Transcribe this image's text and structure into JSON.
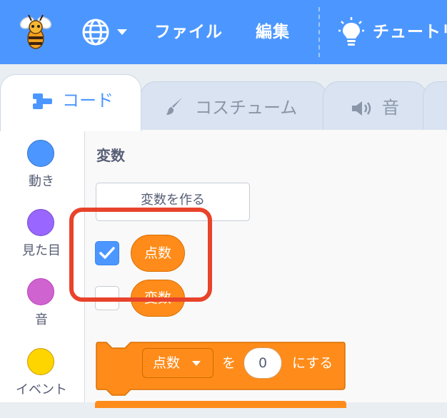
{
  "menubar": {
    "language_icon": "globe-icon",
    "file_label": "ファイル",
    "edit_label": "編集",
    "tutorials_label": "チュートリ",
    "tutorials_icon": "lightbulb-icon",
    "bg_color": "#4c97ff"
  },
  "tabs": [
    {
      "label": "コード",
      "icon": "code-blocks-icon",
      "active": true
    },
    {
      "label": "コスチューム",
      "icon": "paintbrush-icon",
      "active": false
    },
    {
      "label": "音",
      "icon": "speaker-icon",
      "active": false
    }
  ],
  "categories": [
    {
      "label": "動き",
      "color": "#4c97ff"
    },
    {
      "label": "見た目",
      "color": "#9966ff"
    },
    {
      "label": "音",
      "color": "#cf63cf"
    },
    {
      "label": "イベント",
      "color": "#ffd500"
    }
  ],
  "palette": {
    "section_title": "変数",
    "make_variable_label": "変数を作る",
    "variables": [
      {
        "name": "点数",
        "checked": true
      },
      {
        "name": "変数",
        "checked": false
      }
    ],
    "set_block": {
      "variable": "点数",
      "to_text": "を",
      "value": "0",
      "suffix": "にする"
    },
    "highlight_color": "#e8432b",
    "block_color": "#ff8c1a"
  }
}
